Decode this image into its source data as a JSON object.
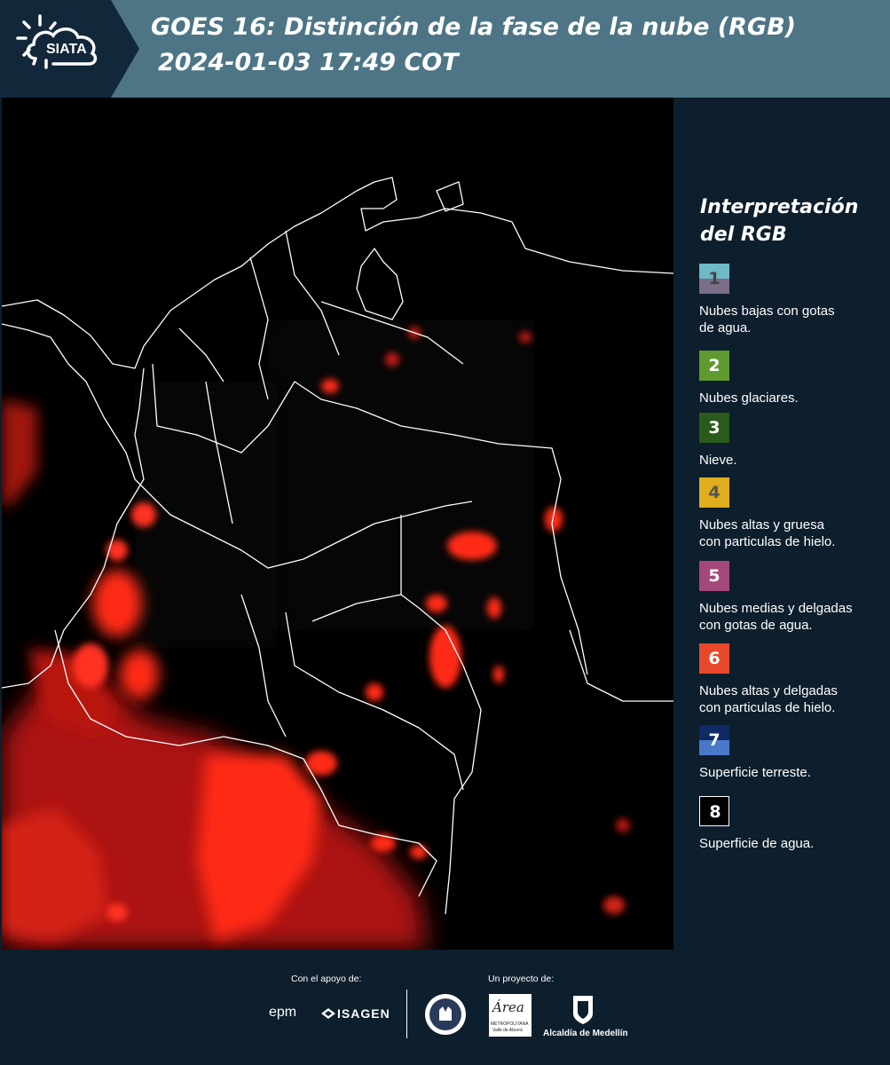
{
  "header": {
    "logo_text": "SIATA",
    "title_line1": "GOES 16: Distinción de la fase de la nube (RGB)",
    "title_line2": "2024-01-03 17:49 COT"
  },
  "legend": {
    "title_line1": "Interpretación",
    "title_line2": "del RGB",
    "items": [
      {
        "num": "1",
        "label_line1": "Nubes bajas con gotas",
        "label_line2": "de agua.",
        "color_top": "#6fb8c6",
        "color_bottom": "#7a6e88",
        "num_color": "#444444"
      },
      {
        "num": "2",
        "label_line1": "Nubes glaciares.",
        "label_line2": "",
        "color_top": "#5f9a2e",
        "color_bottom": "#5f9a2e",
        "num_color": "#ffffff"
      },
      {
        "num": "3",
        "label_line1": "Nieve.",
        "label_line2": "",
        "color_top": "#2a5a1c",
        "color_bottom": "#2a5a1c",
        "num_color": "#ffffff"
      },
      {
        "num": "4",
        "label_line1": "Nubes altas y gruesa",
        "label_line2": "con particulas de hielo.",
        "color_top": "#e0ad1c",
        "color_bottom": "#e0ad1c",
        "num_color": "#555555"
      },
      {
        "num": "5",
        "label_line1": "Nubes medias y delgadas",
        "label_line2": "con gotas de agua.",
        "color_top": "#a4487c",
        "color_bottom": "#a4487c",
        "num_color": "#ffffff"
      },
      {
        "num": "6",
        "label_line1": "Nubes altas y delgadas",
        "label_line2": "con particulas de hielo.",
        "color_top": "#e8482a",
        "color_bottom": "#e8482a",
        "num_color": "#ffffff"
      },
      {
        "num": "7",
        "label_line1": "Superficie terreste.",
        "label_line2": "",
        "color_top": "#102a66",
        "color_bottom": "#4a78c8",
        "num_color": "#ffffff"
      },
      {
        "num": "8",
        "label_line1": "Superficie de agua.",
        "label_line2": "",
        "color_top": "#000000",
        "color_bottom": "#000000",
        "num_color": "#ffffff"
      }
    ]
  },
  "footer": {
    "support_label": "Con el apoyo de:",
    "project_label": "Un proyecto de:",
    "sponsor1": "epm",
    "sponsor2": "ISAGEN",
    "partner1_line1": "Área",
    "partner1_line2": "METROPOLITANA",
    "partner1_line3": "Valle de Aburrá",
    "partner2": "Alcaldía de Medellín"
  },
  "colors": {
    "header_bg": "#4d7585",
    "panel_bg": "#0d1e2c",
    "cloud_red": "#ff2a14",
    "border_line": "#ffffff"
  }
}
